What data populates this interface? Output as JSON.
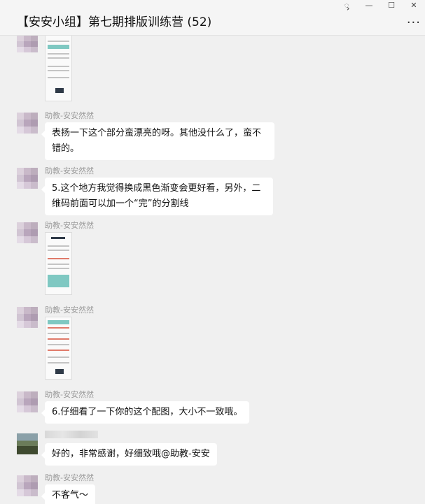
{
  "window": {
    "title": "【安安小组】第七期排版训练营 (52)",
    "buttons": [
      "ᯮ",
      "—",
      "☐",
      "✕"
    ],
    "more": "···"
  },
  "messages": [
    {
      "sender": "",
      "text": ""
    },
    {
      "sender": "助教-安安然然",
      "text": "表扬一下这个部分蛮漂亮的呀。其他没什么了，蛮不错的。"
    },
    {
      "sender": "助教-安安然然",
      "text": "5.这个地方我觉得换成黑色渐变会更好看，另外，二维码前面可以加一个“完”的分割线"
    },
    {
      "sender": "助教-安安然然",
      "text": ""
    },
    {
      "sender": "助教-安安然然",
      "text": ""
    },
    {
      "sender": "助教-安安然然",
      "text": "6.仔细看了一下你的这个配图，大小不一致哦。"
    },
    {
      "sender": "",
      "text": "好的，非常感谢，好细致哦@助教-安安"
    },
    {
      "sender": "助教-安安然然",
      "text": "不客气～"
    }
  ]
}
